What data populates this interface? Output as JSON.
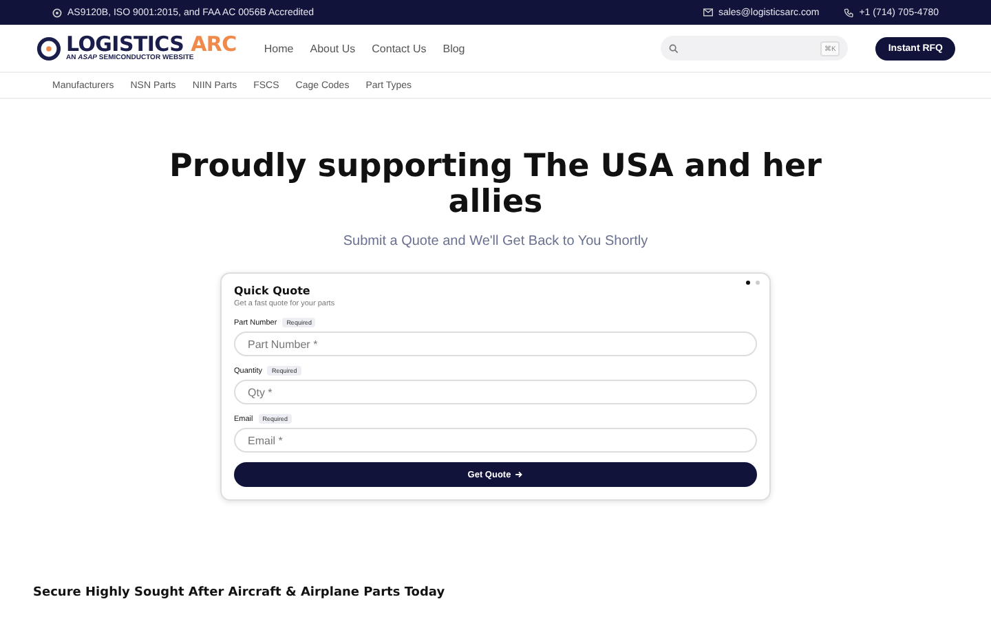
{
  "top_bar": {
    "accreditation": "AS9120B, ISO 9001:2015, and FAA AC 0056B Accredited",
    "email": "sales@logisticsarc.com",
    "phone": "+1 (714) 705-4780"
  },
  "header": {
    "logo": {
      "name": "LOGISTICS",
      "accent": "ARC",
      "tagline_prefix": "AN",
      "tagline_brand": "ASAP",
      "tagline_suffix": "SEMICONDUCTOR WEBSITE"
    },
    "nav": [
      "Home",
      "About Us",
      "Contact Us",
      "Blog"
    ],
    "search": {
      "shortcut": "⌘K"
    },
    "cta": "Instant RFQ"
  },
  "subnav": [
    "Manufacturers",
    "NSN Parts",
    "NIIN Parts",
    "FSCS",
    "Cage Codes",
    "Part Types"
  ],
  "hero": {
    "title": "Proudly supporting The USA and her allies",
    "subtitle": "Submit a Quote and We'll Get Back to You Shortly"
  },
  "quote_card": {
    "title": "Quick Quote",
    "subtitle": "Get a fast quote for your parts",
    "slides": [
      {
        "selected": true
      },
      {
        "selected": false
      }
    ],
    "fields": [
      {
        "label": "Part Number",
        "badge": "Required",
        "placeholder": "Part Number *"
      },
      {
        "label": "Quantity",
        "badge": "Required",
        "placeholder": "Qty *"
      },
      {
        "label": "Email",
        "badge": "Required",
        "placeholder": "Email *"
      }
    ],
    "submit": "Get Quote"
  },
  "section_heading": "Secure Highly Sought After Aircraft & Airplane Parts Today"
}
